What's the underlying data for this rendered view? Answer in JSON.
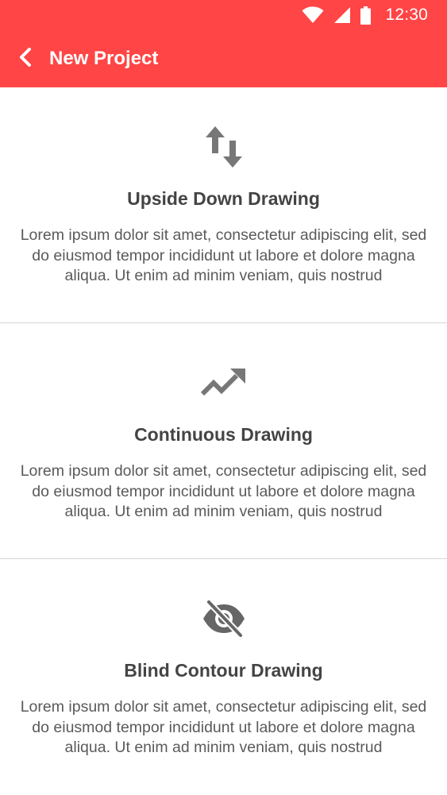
{
  "status_bar": {
    "time": "12:30",
    "icons": [
      "wifi-icon",
      "cell-signal-icon",
      "battery-icon"
    ]
  },
  "app_bar": {
    "title": "New Project",
    "back_icon": "back-arrow-icon",
    "color": "#ff4545"
  },
  "options": [
    {
      "icon": "swap-vertical-icon",
      "title": "Upside Down Drawing",
      "description": "Lorem ipsum dolor sit amet, consectetur adipiscing elit, sed do eiusmod tempor incididunt ut labore et dolore magna aliqua. Ut enim ad minim veniam, quis nostrud"
    },
    {
      "icon": "trending-up-icon",
      "title": "Continuous Drawing",
      "description": "Lorem ipsum dolor sit amet, consectetur adipiscing elit, sed do eiusmod tempor incididunt ut labore et dolore magna aliqua. Ut enim ad minim veniam, quis nostrud"
    },
    {
      "icon": "eye-off-icon",
      "title": "Blind Contour Drawing",
      "description": "Lorem ipsum dolor sit amet, consectetur adipiscing elit, sed do eiusmod tempor incididunt ut labore et dolore magna aliqua. Ut enim ad minim veniam, quis nostrud"
    }
  ]
}
